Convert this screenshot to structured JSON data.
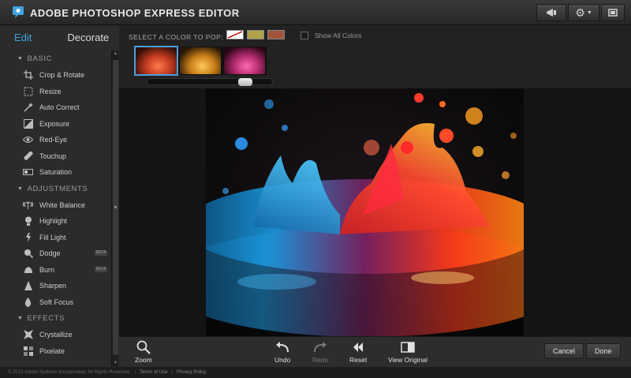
{
  "app": {
    "title": "ADOBE PHOTOSHOP EXPRESS EDITOR"
  },
  "sidebar": {
    "tabs": [
      {
        "label": "Edit"
      },
      {
        "label": "Decorate"
      }
    ],
    "sections": [
      {
        "label": "BASIC",
        "items": [
          {
            "label": "Crop & Rotate",
            "icon": "crop-icon"
          },
          {
            "label": "Resize",
            "icon": "resize-icon"
          },
          {
            "label": "Auto Correct",
            "icon": "wand-icon"
          },
          {
            "label": "Exposure",
            "icon": "exposure-icon"
          },
          {
            "label": "Red-Eye",
            "icon": "eye-icon"
          },
          {
            "label": "Touchup",
            "icon": "bandage-icon"
          },
          {
            "label": "Saturation",
            "icon": "saturation-icon"
          }
        ]
      },
      {
        "label": "ADJUSTMENTS",
        "items": [
          {
            "label": "White Balance",
            "icon": "scale-icon"
          },
          {
            "label": "Highlight",
            "icon": "bulb-icon"
          },
          {
            "label": "Fill Light",
            "icon": "lightning-icon"
          },
          {
            "label": "Dodge",
            "icon": "dodge-icon",
            "tag": "BETA"
          },
          {
            "label": "Burn",
            "icon": "burn-icon",
            "tag": "BETA"
          },
          {
            "label": "Sharpen",
            "icon": "sharpen-icon"
          },
          {
            "label": "Soft Focus",
            "icon": "drop-icon"
          }
        ]
      },
      {
        "label": "EFFECTS",
        "items": [
          {
            "label": "Crystallize",
            "icon": "crystallize-icon"
          },
          {
            "label": "Pixelate",
            "icon": "pixelate-icon"
          }
        ]
      }
    ]
  },
  "options": {
    "pop_label": "SELECT A COLOR TO POP:",
    "swatches": [
      "#ffffff",
      "#b0a14a",
      "#a0553c"
    ],
    "show_all_label": "Show All Colors"
  },
  "bottombar": {
    "zoom_label": "Zoom",
    "undo_label": "Undo",
    "redo_label": "Redo",
    "reset_label": "Reset",
    "view_original_label": "View Original",
    "cancel_label": "Cancel",
    "done_label": "Done"
  },
  "footer": {
    "copyright": "© 2013 Adobe Systems Incorporated. All Rights Reserved.",
    "terms": "Terms of Use",
    "privacy": "Privacy Policy"
  },
  "colors": {
    "accent": "#3fa3e0",
    "background": "#1b1b1b"
  }
}
